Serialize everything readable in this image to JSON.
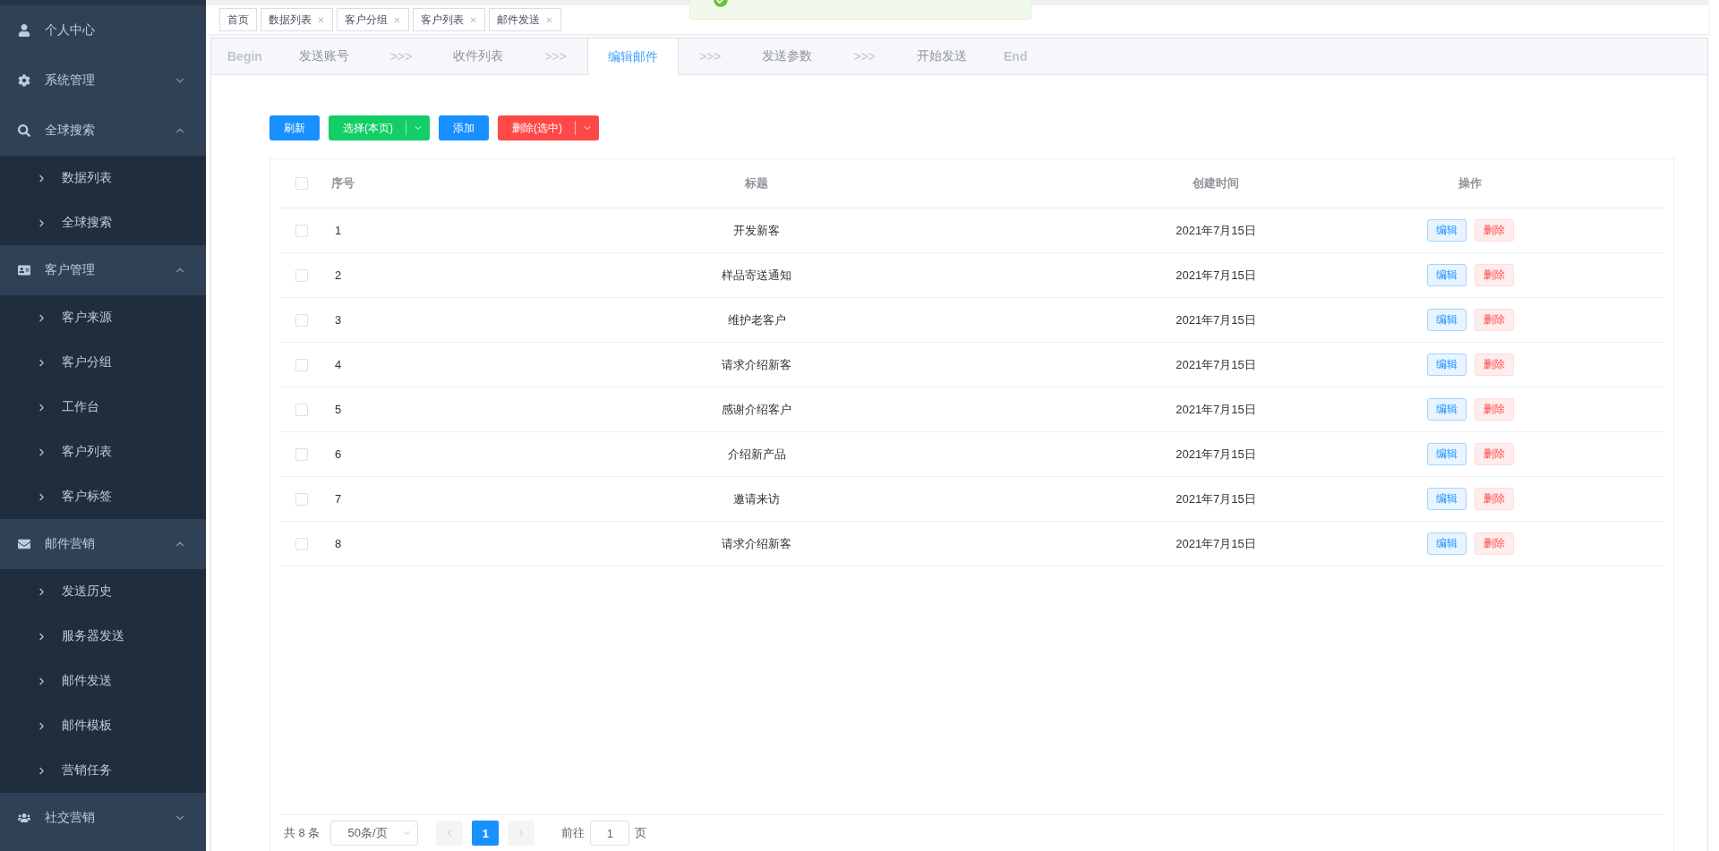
{
  "sidebar": {
    "items": [
      {
        "label": "个人中心",
        "kind": "link"
      },
      {
        "label": "系统管理",
        "kind": "group",
        "expanded": false
      },
      {
        "label": "全球搜索",
        "kind": "group",
        "expanded": true,
        "children": [
          {
            "label": "数据列表"
          },
          {
            "label": "全球搜索"
          }
        ]
      },
      {
        "label": "客户管理",
        "kind": "group",
        "expanded": true,
        "children": [
          {
            "label": "客户来源"
          },
          {
            "label": "客户分组"
          },
          {
            "label": "工作台"
          },
          {
            "label": "客户列表"
          },
          {
            "label": "客户标签"
          }
        ]
      },
      {
        "label": "邮件营销",
        "kind": "group",
        "expanded": true,
        "children": [
          {
            "label": "发送历史"
          },
          {
            "label": "服务器发送"
          },
          {
            "label": "邮件发送"
          },
          {
            "label": "邮件模板"
          },
          {
            "label": "营销任务"
          }
        ]
      },
      {
        "label": "社交营销",
        "kind": "group",
        "expanded": false
      }
    ]
  },
  "tags": [
    {
      "label": "首页",
      "closable": false
    },
    {
      "label": "数据列表",
      "closable": true
    },
    {
      "label": "客户分组",
      "closable": true
    },
    {
      "label": "客户列表",
      "closable": true
    },
    {
      "label": "邮件发送",
      "closable": true
    }
  ],
  "toast": {
    "kind": "success"
  },
  "steps": [
    {
      "label": "Begin",
      "kind": "end",
      "selected": false
    },
    {
      "label": "发送账号",
      "kind": "step",
      "selected": false
    },
    {
      "label": ">>>",
      "kind": "arrow",
      "selected": false
    },
    {
      "label": "收件列表",
      "kind": "step",
      "selected": false
    },
    {
      "label": ">>>",
      "kind": "arrow",
      "selected": false
    },
    {
      "label": "编辑邮件",
      "kind": "step",
      "selected": true
    },
    {
      "label": ">>>",
      "kind": "arrow",
      "selected": false
    },
    {
      "label": "发送参数",
      "kind": "step",
      "selected": false
    },
    {
      "label": ">>>",
      "kind": "arrow",
      "selected": false
    },
    {
      "label": "开始发送",
      "kind": "step",
      "selected": false
    },
    {
      "label": "End",
      "kind": "end",
      "selected": false
    }
  ],
  "toolbar": [
    {
      "label": "刷新",
      "kind": "primary",
      "split": false
    },
    {
      "label": "选择(本页)",
      "kind": "success",
      "split": true
    },
    {
      "label": "添加",
      "kind": "primary",
      "split": false
    },
    {
      "label": "删除(选中)",
      "kind": "danger",
      "split": true
    }
  ],
  "table": {
    "checked": false,
    "columns": [
      "序号",
      "标题",
      "创建时间",
      "操作"
    ],
    "rows": [
      {
        "index": "1",
        "title": "开发新客",
        "created": "2021年7月15日",
        "actions": [
          "编辑",
          "删除"
        ],
        "checked": false
      },
      {
        "index": "2",
        "title": "样品寄送通知",
        "created": "2021年7月15日",
        "actions": [
          "编辑",
          "删除"
        ],
        "checked": false
      },
      {
        "index": "3",
        "title": "维护老客户",
        "created": "2021年7月15日",
        "actions": [
          "编辑",
          "删除"
        ],
        "checked": false
      },
      {
        "index": "4",
        "title": "请求介绍新客",
        "created": "2021年7月15日",
        "actions": [
          "编辑",
          "删除"
        ],
        "checked": false
      },
      {
        "index": "5",
        "title": "感谢介绍客户",
        "created": "2021年7月15日",
        "actions": [
          "编辑",
          "删除"
        ],
        "checked": false
      },
      {
        "index": "6",
        "title": "介绍新产品",
        "created": "2021年7月15日",
        "actions": [
          "编辑",
          "删除"
        ],
        "checked": false
      },
      {
        "index": "7",
        "title": "邀请来访",
        "created": "2021年7月15日",
        "actions": [
          "编辑",
          "删除"
        ],
        "checked": false
      },
      {
        "index": "8",
        "title": "请求介绍新客",
        "created": "2021年7月15日",
        "actions": [
          "编辑",
          "删除"
        ],
        "checked": false
      }
    ]
  },
  "pagination": {
    "total": "共 8 条",
    "page_size": "50条/页",
    "prev_disabled": true,
    "next_disabled": true,
    "pages": [
      {
        "label": "1",
        "selected": true
      }
    ],
    "goto_label": "前往",
    "goto_value": "1",
    "goto_suffix": "页"
  }
}
